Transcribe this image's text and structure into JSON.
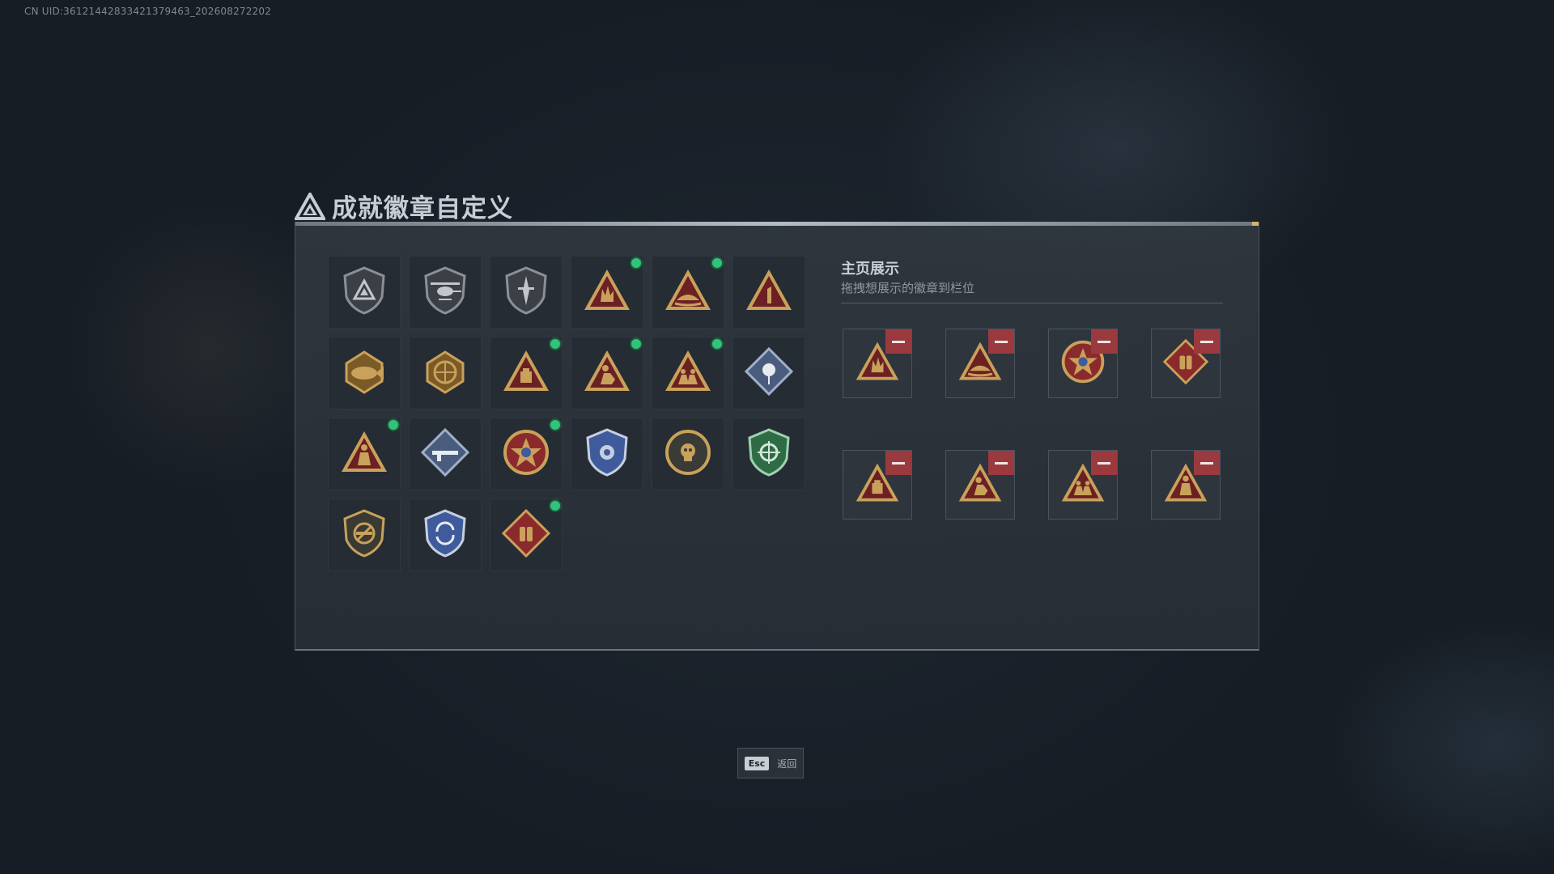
{
  "uid_text": "CN UID:3612144283342137946​3_202608272202",
  "title": "成就徽章自定义",
  "showcase": {
    "title": "主页展示",
    "subtitle": "拖拽想展示的徽章到栏位"
  },
  "esc": {
    "key": "Esc",
    "label": "返回"
  },
  "badges": [
    {
      "icon": "shield-triangle-badge-icon",
      "new": false
    },
    {
      "icon": "helicopter-badge-icon",
      "new": false
    },
    {
      "icon": "dagger-shield-badge-icon",
      "new": false
    },
    {
      "icon": "hand-sign-triangle-badge-icon",
      "new": true
    },
    {
      "icon": "boat-triangle-badge-icon",
      "new": true
    },
    {
      "icon": "number-one-triangle-badge-icon",
      "new": false
    },
    {
      "icon": "fish-emblem-badge-icon",
      "new": false
    },
    {
      "icon": "globe-emblem-badge-icon",
      "new": false
    },
    {
      "icon": "crate-triangle-badge-icon",
      "new": true
    },
    {
      "icon": "kneeling-soldier-triangle-badge-icon",
      "new": true
    },
    {
      "icon": "squad-triangle-badge-icon",
      "new": true
    },
    {
      "icon": "rose-diamond-badge-icon",
      "new": false
    },
    {
      "icon": "soldier-triangle-badge-icon",
      "new": true
    },
    {
      "icon": "rifle-diamond-badge-icon",
      "new": false
    },
    {
      "icon": "star-ring-badge-icon",
      "new": true
    },
    {
      "icon": "police-shield-badge-icon",
      "new": false
    },
    {
      "icon": "skull-coin-badge-icon",
      "new": false
    },
    {
      "icon": "crosshair-green-shield-badge-icon",
      "new": false
    },
    {
      "icon": "no-gun-shield-badge-icon",
      "new": false
    },
    {
      "icon": "arrows-blue-shield-badge-icon",
      "new": false
    },
    {
      "icon": "armor-vest-diamond-badge-icon",
      "new": true
    }
  ],
  "slots": [
    {
      "icon": "hand-sign-triangle-badge-icon"
    },
    {
      "icon": "boat-triangle-badge-icon"
    },
    {
      "icon": "star-ring-badge-icon"
    },
    {
      "icon": "armor-vest-diamond-badge-icon"
    },
    {
      "icon": "crate-triangle-badge-icon"
    },
    {
      "icon": "kneeling-soldier-triangle-badge-icon"
    },
    {
      "icon": "squad-triangle-badge-icon"
    },
    {
      "icon": "soldier-triangle-badge-icon"
    }
  ],
  "colors": {
    "gold": "#c9a15a",
    "gold_dark": "#7a5a26",
    "red_inner": "#6b2023",
    "new_dot": "#2fc47a",
    "remove_button": "#9a3a3e",
    "blue_shield": "#3f5b9c",
    "green_shield": "#2f6b45"
  }
}
